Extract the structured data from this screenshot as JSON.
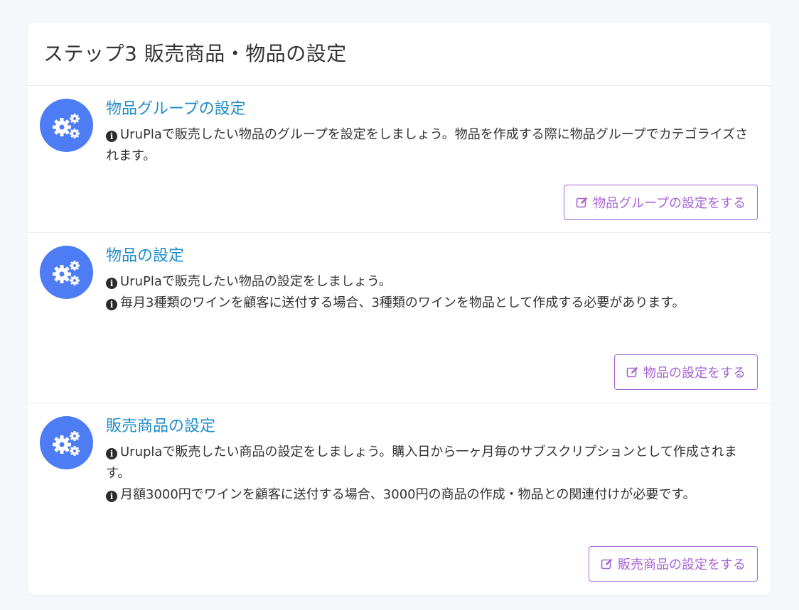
{
  "card": {
    "title": "ステップ3 販売商品・物品の設定"
  },
  "sections": [
    {
      "icon": "gears-icon",
      "title": "物品グループの設定",
      "lines": [
        "UruPlaで販売したい物品のグループを設定をしましょう。物品を作成する際に物品グループでカテゴライズされます。"
      ],
      "button_label": "物品グループの設定をする"
    },
    {
      "icon": "gears-icon",
      "title": "物品の設定",
      "lines": [
        "UruPlaで販売したい物品の設定をしましょう。",
        "毎月3種類のワインを顧客に送付する場合、3種類のワインを物品として作成する必要があります。"
      ],
      "button_label": "物品の設定をする"
    },
    {
      "icon": "gears-icon",
      "title": "販売商品の設定",
      "lines": [
        "Uruplaで販売したい商品の設定をしましょう。購入日から一ヶ月毎のサブスクリプションとして作成されます。",
        "月額3000円でワインを顧客に送付する場合、3000円の商品の作成・物品との関連付けが必要です。"
      ],
      "button_label": "販売商品の設定をする"
    }
  ],
  "colors": {
    "accent_blue": "#4d7cf5",
    "title_blue": "#1f8bc9",
    "button_purple": "#a663d6"
  }
}
